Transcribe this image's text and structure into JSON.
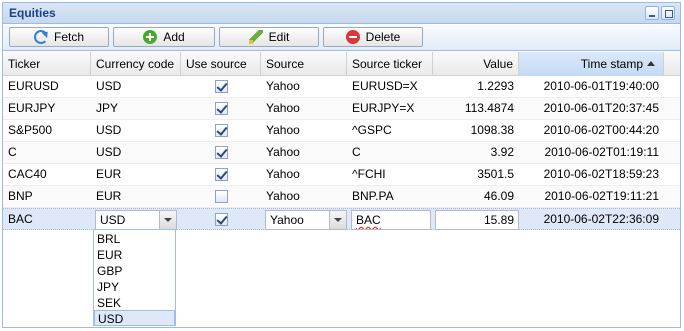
{
  "window": {
    "title": "Equities"
  },
  "toolbar": {
    "fetch_label": "Fetch",
    "add_label": "Add",
    "edit_label": "Edit",
    "delete_label": "Delete"
  },
  "columns": {
    "ticker": "Ticker",
    "currency": "Currency code",
    "use_source": "Use source",
    "source": "Source",
    "source_ticker": "Source ticker",
    "value": "Value",
    "timestamp": "Time stamp"
  },
  "rows": [
    {
      "ticker": "EURUSD",
      "currency": "USD",
      "use_source": true,
      "source": "Yahoo",
      "source_ticker": "EURUSD=X",
      "value": "1.2293",
      "timestamp": "2010-06-01T19:40:00"
    },
    {
      "ticker": "EURJPY",
      "currency": "JPY",
      "use_source": true,
      "source": "Yahoo",
      "source_ticker": "EURJPY=X",
      "value": "113.4874",
      "timestamp": "2010-06-01T20:37:45"
    },
    {
      "ticker": "S&P500",
      "currency": "USD",
      "use_source": true,
      "source": "Yahoo",
      "source_ticker": "^GSPC",
      "value": "1098.38",
      "timestamp": "2010-06-02T00:44:20"
    },
    {
      "ticker": "C",
      "currency": "USD",
      "use_source": true,
      "source": "Yahoo",
      "source_ticker": "C",
      "value": "3.92",
      "timestamp": "2010-06-02T01:19:11"
    },
    {
      "ticker": "CAC40",
      "currency": "EUR",
      "use_source": true,
      "source": "Yahoo",
      "source_ticker": "^FCHI",
      "value": "3501.5",
      "timestamp": "2010-06-02T18:59:23"
    },
    {
      "ticker": "BNP",
      "currency": "EUR",
      "use_source": false,
      "source": "Yahoo",
      "source_ticker": "BNP.PA",
      "value": "46.09",
      "timestamp": "2010-06-02T19:11:21"
    }
  ],
  "editing_row": {
    "ticker": "BAC",
    "currency": "USD",
    "use_source": true,
    "source": "Yahoo",
    "source_ticker": "BAC",
    "value": "15.89",
    "timestamp": "2010-06-02T22:36:09"
  },
  "currency_options": [
    "BRL",
    "EUR",
    "GBP",
    "JPY",
    "SEK",
    "USD"
  ],
  "currency_selected": "USD"
}
